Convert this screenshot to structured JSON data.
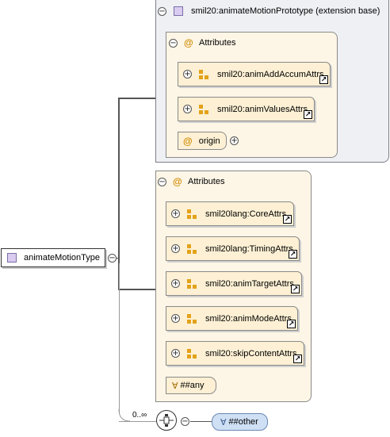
{
  "root_element": {
    "label": "animateMotionType",
    "icon": "element-icon"
  },
  "extension_base": {
    "label": "smil20:animateMotionPrototype (extension base)",
    "attributes_label": "Attributes",
    "attribute_groups": [
      {
        "label": "smil20:animAddAccumAttrs"
      },
      {
        "label": "smil20:animValuesAttrs"
      }
    ],
    "attribute": {
      "label": "origin"
    }
  },
  "attributes": {
    "label": "Attributes",
    "groups": [
      {
        "label": "smil20lang:CoreAttrs"
      },
      {
        "label": "smil20lang:TimingAttrs"
      },
      {
        "label": "smil20:animTargetAttrs"
      },
      {
        "label": "smil20:animModeAttrs"
      },
      {
        "label": "smil20:skipContentAttrs"
      }
    ],
    "any_attribute": {
      "label": "##any"
    }
  },
  "sequence": {
    "cardinality": "0..∞"
  },
  "any_element": {
    "label": "##other"
  },
  "symbols": {
    "collapse": "−",
    "expand": "+",
    "at": "@",
    "forall": "∀",
    "link": "↗"
  },
  "colors": {
    "element_fill": "#d9ccf0",
    "group_fill": "#fdf0d4",
    "extension_fill": "#eef0f4",
    "any_other_fill": "#cfe0f5",
    "group_icon": "#e3a21a"
  }
}
